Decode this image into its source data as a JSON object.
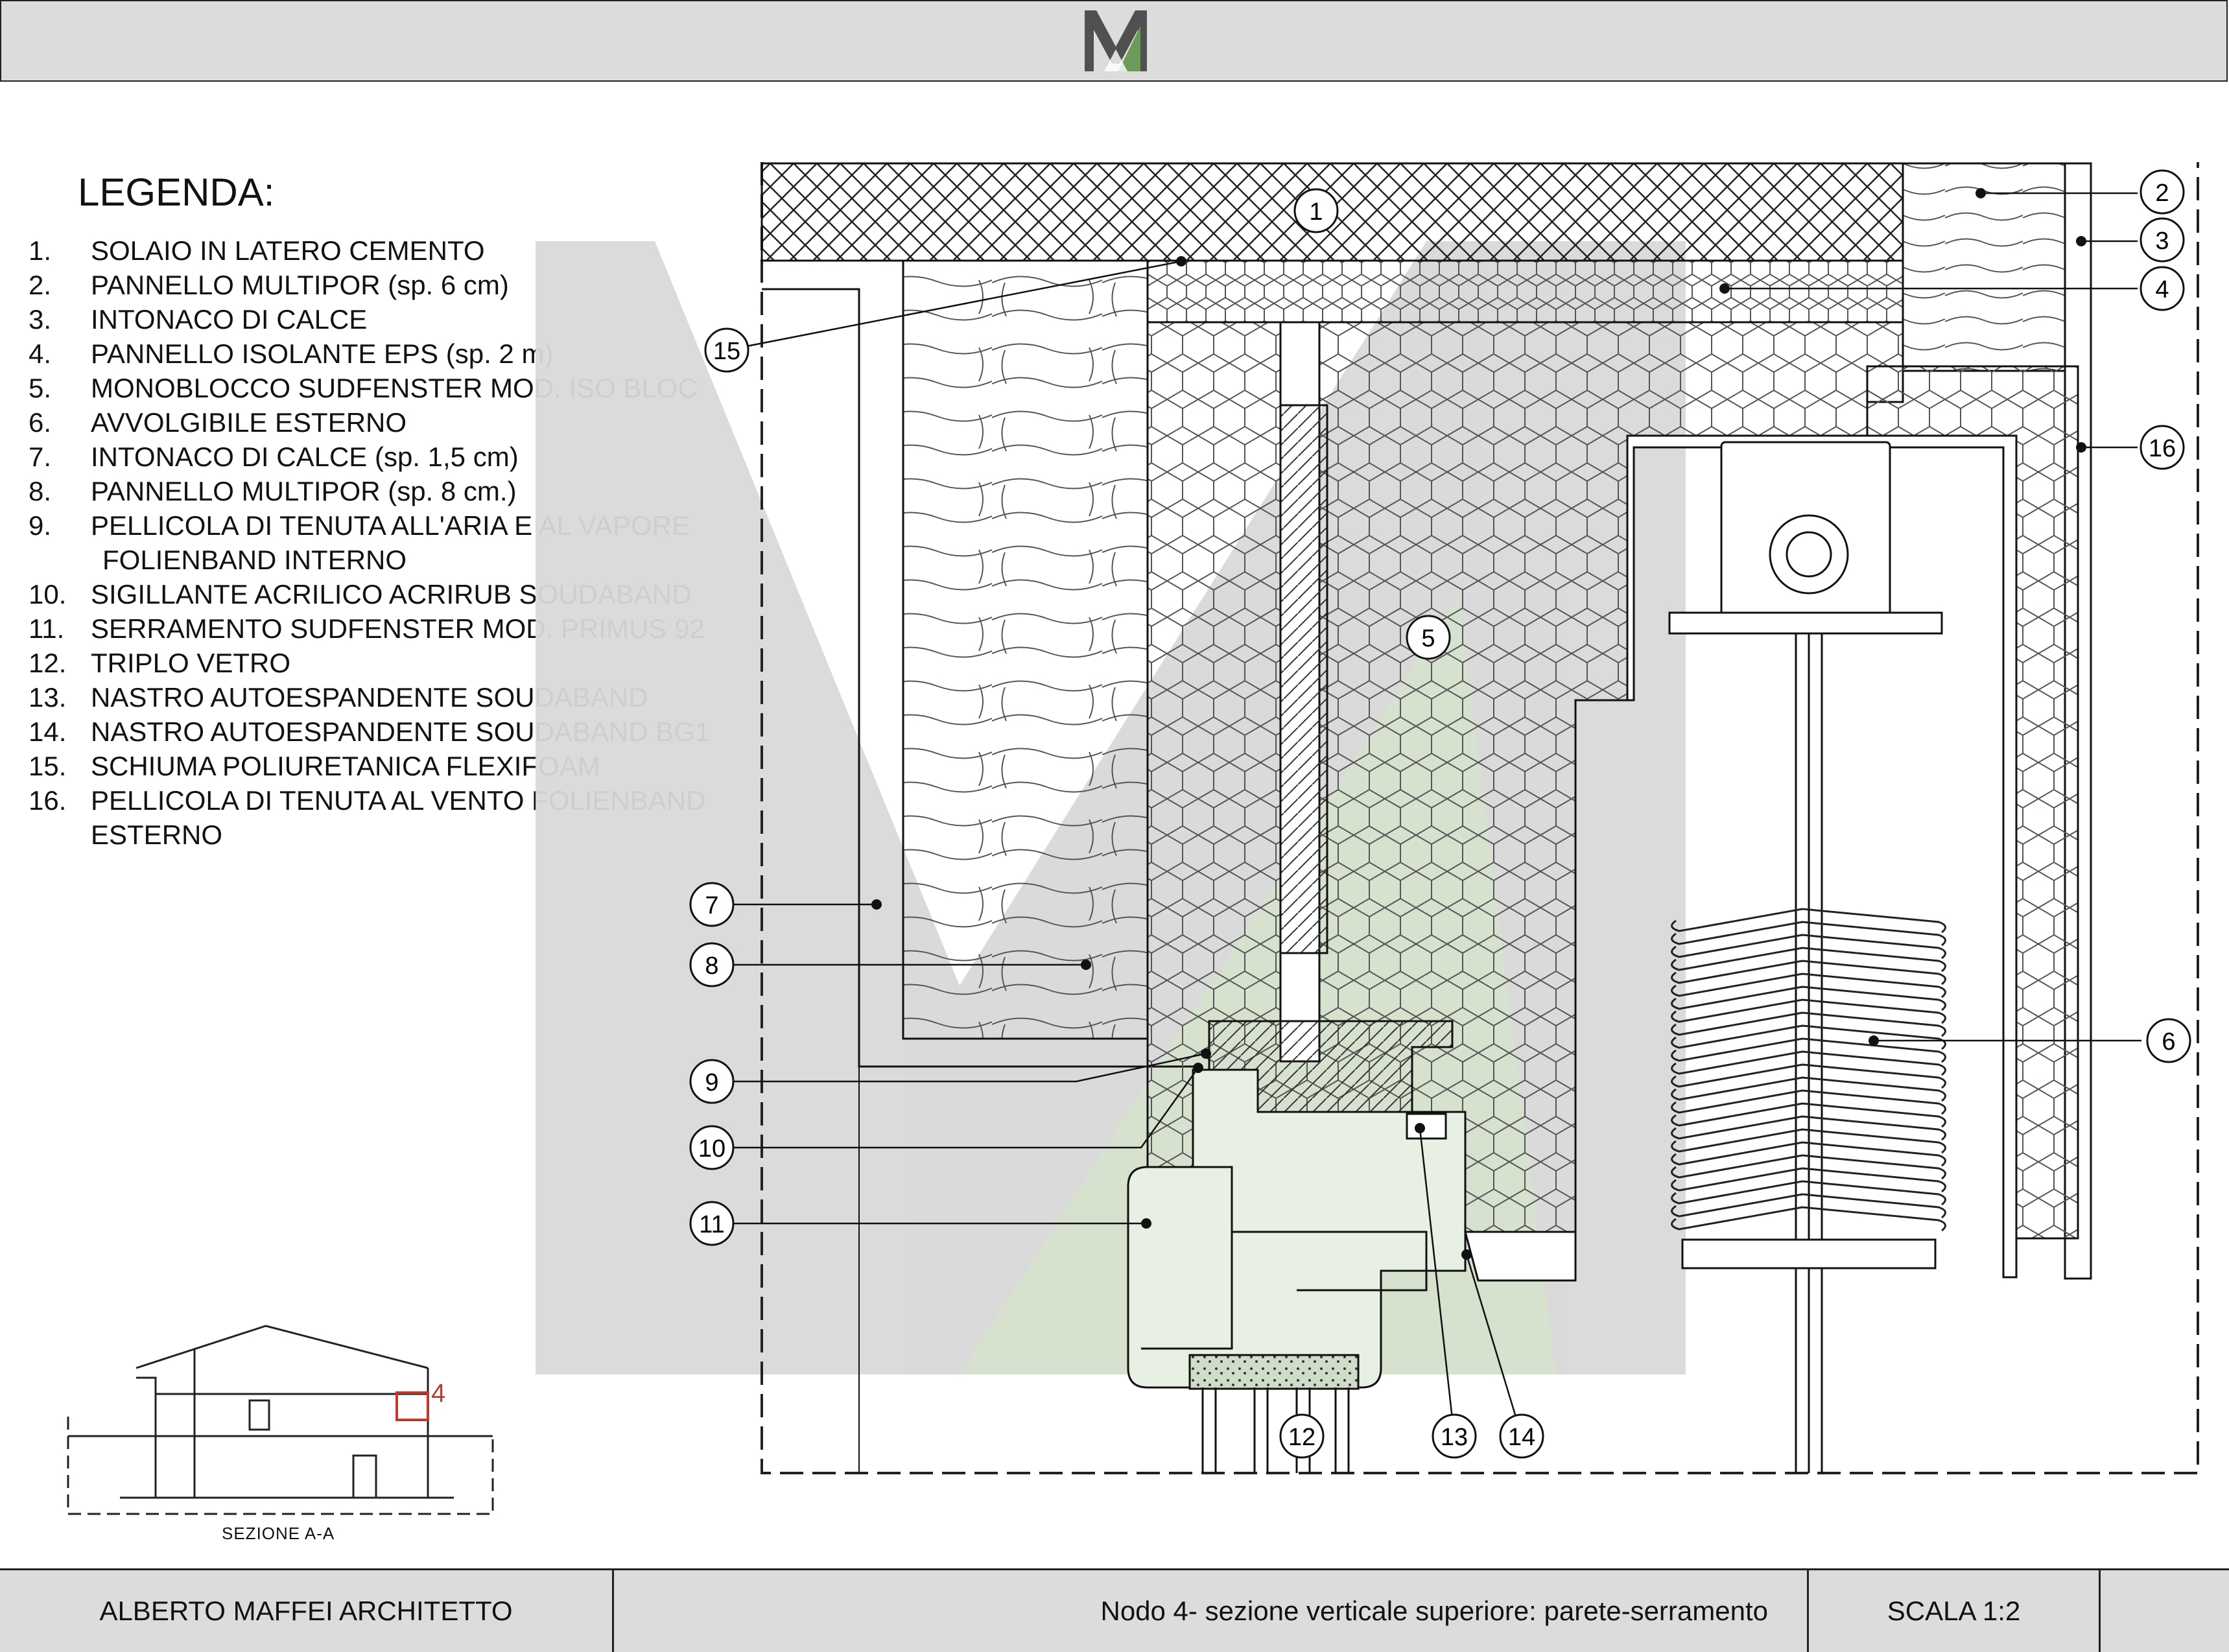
{
  "legend": {
    "title": "LEGENDA:",
    "items": [
      {
        "num": "1.",
        "text": "SOLAIO IN LATERO CEMENTO"
      },
      {
        "num": "2.",
        "text": "PANNELLO MULTIPOR (sp. 6 cm)"
      },
      {
        "num": "3.",
        "text": "INTONACO DI CALCE"
      },
      {
        "num": "4.",
        "text": "PANNELLO ISOLANTE EPS (sp. 2 m)"
      },
      {
        "num": "5.",
        "text": "MONOBLOCCO SUDFENSTER MOD. ISO BLOC"
      },
      {
        "num": "6.",
        "text": "AVVOLGIBILE ESTERNO"
      },
      {
        "num": "7.",
        "text": "INTONACO DI CALCE (sp. 1,5 cm)"
      },
      {
        "num": "8.",
        "text": "PANNELLO MULTIPOR (sp. 8 cm.)"
      },
      {
        "num": "9.",
        "text": "PELLICOLA DI TENUTA ALL'ARIA E AL VAPORE",
        "cont": "FOLIENBAND INTERNO"
      },
      {
        "num": "10.",
        "text": "SIGILLANTE ACRILICO ACRIRUB SOUDABAND"
      },
      {
        "num": "11.",
        "text": "SERRAMENTO SUDFENSTER MOD. PRIMUS 92"
      },
      {
        "num": "12.",
        "text": "TRIPLO VETRO"
      },
      {
        "num": "13.",
        "text": "NASTRO AUTOESPANDENTE SOUDABAND"
      },
      {
        "num": "14.",
        "text": "NASTRO AUTOESPANDENTE SOUDABAND BG1"
      },
      {
        "num": "15.",
        "text": "SCHIUMA POLIURETANICA FLEXIFOAM"
      },
      {
        "num": "16.",
        "text": "PELLICOLA DI TENUTA AL VENTO FOLIENBAND",
        "cont": "ESTERNO"
      }
    ]
  },
  "callouts": [
    "1",
    "2",
    "3",
    "4",
    "5",
    "6",
    "7",
    "8",
    "9",
    "10",
    "11",
    "12",
    "13",
    "14",
    "15",
    "16"
  ],
  "key_plan": {
    "label": "SEZIONE A-A",
    "marker": "4"
  },
  "footer": {
    "author": "ALBERTO MAFFEI ARCHITETTO",
    "title": "Nodo 4- sezione verticale superiore: parete-serramento",
    "scale": "SCALA 1:2"
  },
  "colors": {
    "header_bg": "#dcdcdc",
    "watermark_gray": "#d9d9d9",
    "watermark_green": "#d4e0cc",
    "marker_red": "#c0392b"
  }
}
